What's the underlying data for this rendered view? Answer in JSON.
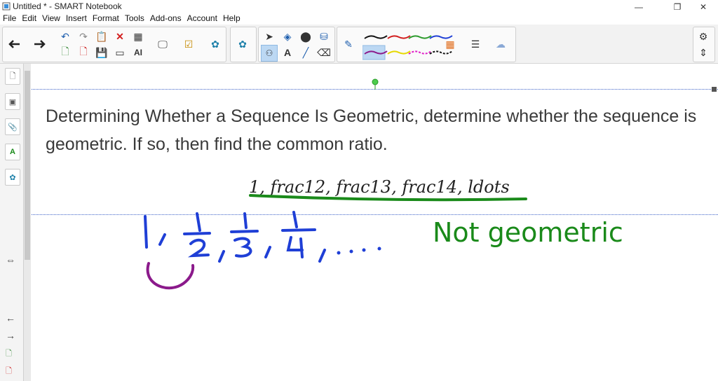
{
  "window": {
    "title": "Untitled * - SMART Notebook",
    "minimize": "—",
    "maximize": "❐",
    "close": "✕"
  },
  "menu": [
    "File",
    "Edit",
    "View",
    "Insert",
    "Format",
    "Tools",
    "Add-ons",
    "Account",
    "Help"
  ],
  "content": {
    "heading": "Determining Whether a Sequence Is Geometric, determine whether the sequence is geometric. If so, then find the common ratio.",
    "sequence": "1, frac12, frac13, frac14, ldots",
    "handwritten_sequence": [
      "1,",
      "1/2,",
      "1/3,",
      "1/4,",
      "...."
    ],
    "handwritten_answer": "Not geometric"
  },
  "colors": {
    "ink_blue": "#1f3fd6",
    "ink_green": "#1a8a1a",
    "ink_purple": "#8b1a8b",
    "dotted_line": "#3e62c8",
    "toolbar_bg": "#f2f2f2"
  },
  "sidebar_icons": [
    "page-sorter-icon",
    "gallery-icon",
    "attachments-icon",
    "properties-icon",
    "add-ons-icon",
    "resize-icon",
    "back-icon",
    "forward-icon",
    "page-icon",
    "page-delete-icon"
  ]
}
